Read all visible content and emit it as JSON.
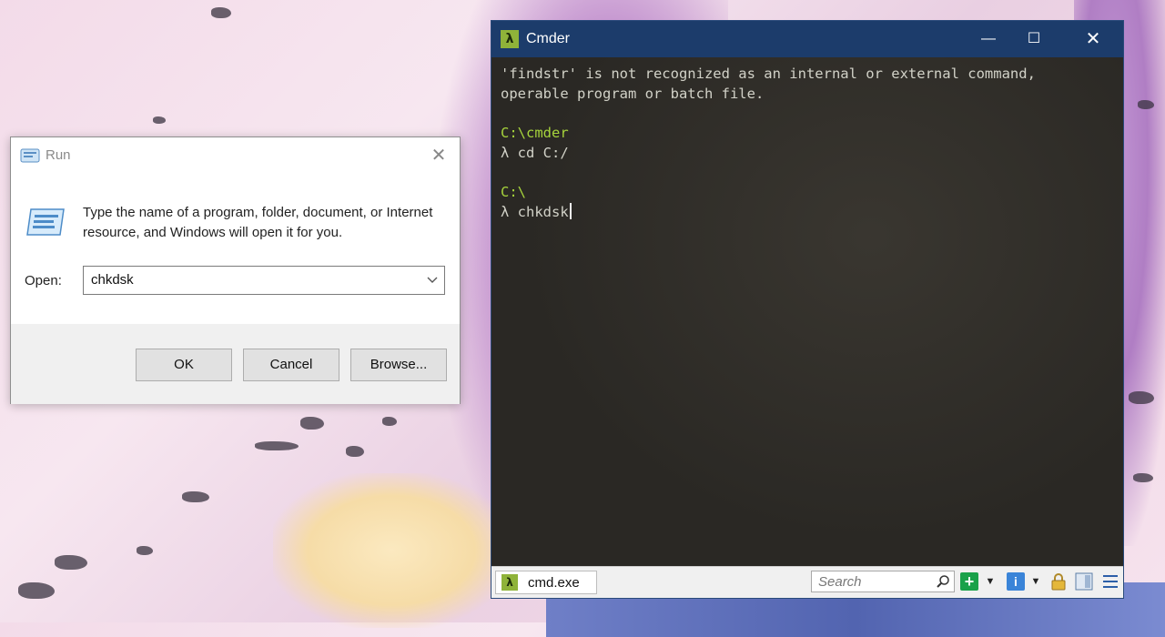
{
  "run_dialog": {
    "title": "Run",
    "description": "Type the name of a program, folder, document, or Internet resource, and Windows will open it for you.",
    "open_label": "Open:",
    "open_value": "chkdsk",
    "ok_label": "OK",
    "cancel_label": "Cancel",
    "browse_label": "Browse...",
    "close_icon": "close-icon",
    "run_icon": "run-icon"
  },
  "cmder": {
    "title": "Cmder",
    "logo_glyph": "λ",
    "controls": {
      "minimize": "—",
      "maximize": "☐",
      "close": "✕"
    },
    "console": {
      "line1": "'findstr' is not recognized as an internal or external command,",
      "line2": "operable program or batch file.",
      "prompt1_path": "C:\\cmder",
      "prompt1_cmd": "λ cd C:/",
      "prompt2_path": "C:\\",
      "prompt2_cmd": "λ chkdsk"
    },
    "status": {
      "tab_label": "cmd.exe",
      "search_placeholder": "Search",
      "icons": [
        "search-icon",
        "add-console-icon",
        "dropdown-icon",
        "info-icon",
        "dropdown-icon",
        "lock-icon",
        "panel-icon",
        "menu-icon"
      ]
    },
    "colors": {
      "titlebar": "#1c3c6b",
      "prompt_green": "#a6d33c",
      "console_bg": "#2a2824"
    }
  }
}
